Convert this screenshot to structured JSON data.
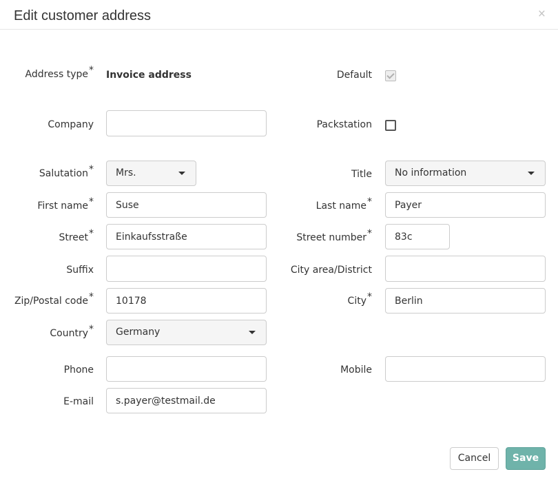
{
  "dialog": {
    "title": "Edit customer address",
    "close_label": "×"
  },
  "required_marker": "*",
  "fields": {
    "address_type": {
      "label": "Address type",
      "value": "Invoice address"
    },
    "default": {
      "label": "Default",
      "checked": true,
      "disabled": true
    },
    "company": {
      "label": "Company",
      "value": ""
    },
    "packstation": {
      "label": "Packstation",
      "checked": false
    },
    "salutation": {
      "label": "Salutation",
      "value": "Mrs."
    },
    "title": {
      "label": "Title",
      "value": "No information"
    },
    "first_name": {
      "label": "First name",
      "value": "Suse"
    },
    "last_name": {
      "label": "Last name",
      "value": "Payer"
    },
    "street": {
      "label": "Street",
      "value": "Einkaufsstraße"
    },
    "street_number": {
      "label": "Street number",
      "value": "83c"
    },
    "suffix": {
      "label": "Suffix",
      "value": ""
    },
    "city_area": {
      "label": "City area/District",
      "value": ""
    },
    "zip": {
      "label": "Zip/Postal code",
      "value": "10178"
    },
    "city": {
      "label": "City",
      "value": "Berlin"
    },
    "country": {
      "label": "Country",
      "value": "Germany"
    },
    "phone": {
      "label": "Phone",
      "value": ""
    },
    "mobile": {
      "label": "Mobile",
      "value": ""
    },
    "email": {
      "label": "E-mail",
      "value": "s.payer@testmail.de"
    }
  },
  "buttons": {
    "cancel": "Cancel",
    "save": "Save"
  },
  "colors": {
    "save_button": "#6fb3aa",
    "border": "#cccccc",
    "select_bg": "#f5f5f5"
  }
}
